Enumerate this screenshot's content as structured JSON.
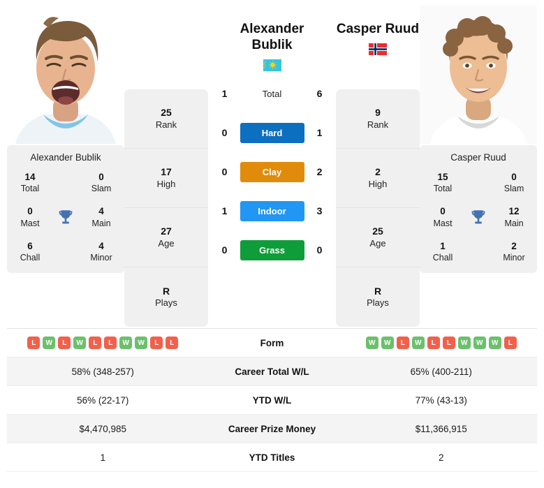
{
  "left_player": {
    "name": "Alexander Bublik",
    "display_name_line1": "Alexander",
    "display_name_line2": "Bublik",
    "country": "Kazakhstan",
    "flag_icon": "kazakhstan-flag",
    "photo_alt": "Alexander Bublik photo",
    "titles": {
      "total_value": "14",
      "total_label": "Total",
      "slam_value": "0",
      "slam_label": "Slam",
      "mast_value": "0",
      "mast_label": "Mast",
      "main_value": "4",
      "main_label": "Main",
      "chall_value": "6",
      "chall_label": "Chall",
      "minor_value": "4",
      "minor_label": "Minor",
      "trophy_icon": "trophy-icon"
    },
    "card": [
      {
        "value": "25",
        "label": "Rank"
      },
      {
        "value": "17",
        "label": "High"
      },
      {
        "value": "27",
        "label": "Age"
      },
      {
        "value": "R",
        "label": "Plays"
      }
    ],
    "form": [
      "L",
      "W",
      "L",
      "W",
      "L",
      "L",
      "W",
      "W",
      "L",
      "L"
    ],
    "career_total_wl": "58% (348-257)",
    "ytd_wl": "56% (22-17)",
    "career_prize_money": "$4,470,985",
    "ytd_titles": "1"
  },
  "right_player": {
    "name": "Casper Ruud",
    "display_name_line1": "Casper Ruud",
    "display_name_line2": "",
    "country": "Norway",
    "flag_icon": "norway-flag",
    "photo_alt": "Casper Ruud photo",
    "titles": {
      "total_value": "15",
      "total_label": "Total",
      "slam_value": "0",
      "slam_label": "Slam",
      "mast_value": "0",
      "mast_label": "Mast",
      "main_value": "12",
      "main_label": "Main",
      "chall_value": "1",
      "chall_label": "Chall",
      "minor_value": "2",
      "minor_label": "Minor",
      "trophy_icon": "trophy-icon"
    },
    "card": [
      {
        "value": "9",
        "label": "Rank"
      },
      {
        "value": "2",
        "label": "High"
      },
      {
        "value": "25",
        "label": "Age"
      },
      {
        "value": "R",
        "label": "Plays"
      }
    ],
    "form": [
      "W",
      "W",
      "L",
      "W",
      "L",
      "L",
      "W",
      "W",
      "W",
      "L"
    ],
    "career_total_wl": "65% (400-211)",
    "ytd_wl": "77% (43-13)",
    "career_prize_money": "$11,366,915",
    "ytd_titles": "2"
  },
  "head_to_head": [
    {
      "label": "Total",
      "left": "1",
      "right": "6",
      "type": "plain",
      "color": ""
    },
    {
      "label": "Hard",
      "left": "0",
      "right": "1",
      "type": "badge",
      "color": "#0d6fbf"
    },
    {
      "label": "Clay",
      "left": "0",
      "right": "2",
      "type": "badge",
      "color": "#e08c0a"
    },
    {
      "label": "Indoor",
      "left": "1",
      "right": "3",
      "type": "badge",
      "color": "#2196f3"
    },
    {
      "label": "Grass",
      "left": "0",
      "right": "0",
      "type": "badge",
      "color": "#0f9d3a"
    }
  ],
  "table_labels": {
    "form": "Form",
    "career_total_wl": "Career Total W/L",
    "ytd_wl": "YTD W/L",
    "career_prize_money": "Career Prize Money",
    "ytd_titles": "YTD Titles"
  },
  "colors": {
    "hard": "#0d6fbf",
    "clay": "#e08c0a",
    "indoor": "#2196f3",
    "grass": "#0f9d3a",
    "win": "#6cc06c",
    "loss": "#f2604b",
    "trophy": "#4472b0",
    "panel_bg": "#f0f0f0"
  }
}
